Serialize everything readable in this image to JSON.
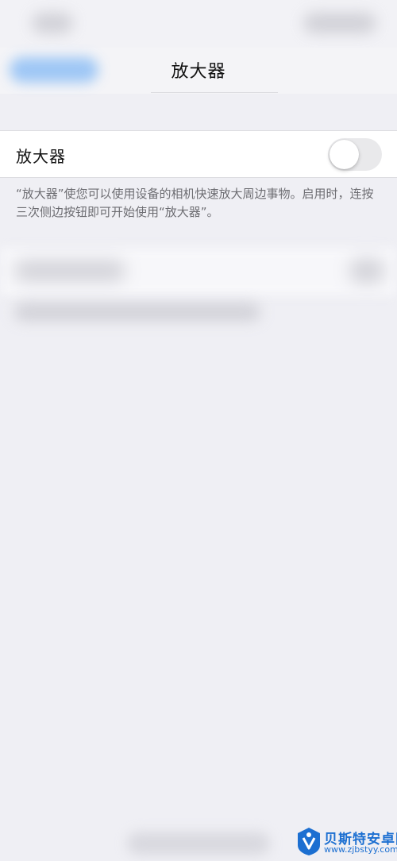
{
  "nav": {
    "title": "放大器"
  },
  "setting": {
    "label": "放大器",
    "toggle_on": false
  },
  "footer": {
    "description": "“放大器”使您可以使用设备的相机快速放大周边事物。启用时，连按三次侧边按钮即可开始使用“放大器”。"
  },
  "watermark": {
    "name": "贝斯特安卓网",
    "url": "www.zjbstyy.com"
  },
  "colors": {
    "background": "#efeff4",
    "cell": "#ffffff",
    "toggle_off": "#e9e9eb",
    "footer_text": "#6d6d72",
    "watermark": "#1c6fd1"
  }
}
